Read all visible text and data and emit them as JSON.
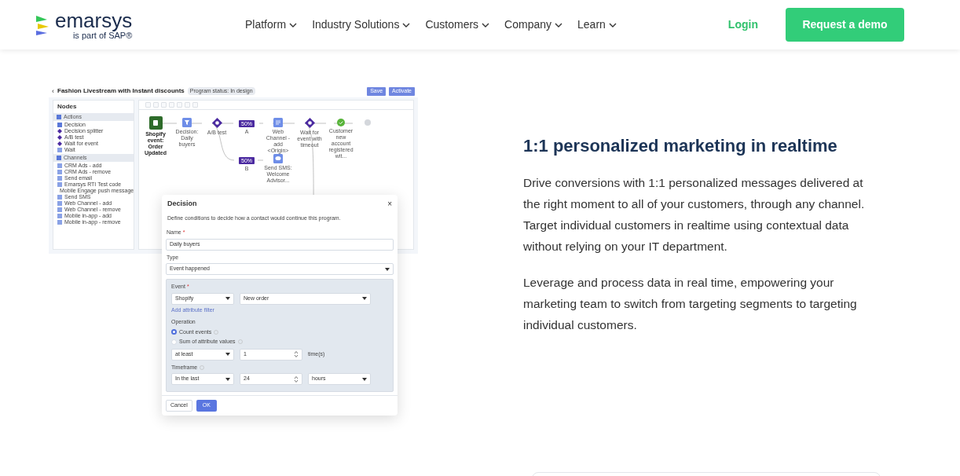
{
  "header": {
    "logo": {
      "name": "emarsys",
      "tagline": "is part of SAP®"
    },
    "nav": [
      {
        "label": "Platform"
      },
      {
        "label": "Industry Solutions"
      },
      {
        "label": "Customers"
      },
      {
        "label": "Company"
      },
      {
        "label": "Learn"
      }
    ],
    "login": "Login",
    "cta": "Request a demo"
  },
  "app_preview": {
    "back": "‹",
    "title": "Fashion Livestream with Instant discounts",
    "status": "Program status: In design",
    "buttons": [
      "Save",
      "Activate"
    ],
    "nodes_panel": {
      "title": "Nodes",
      "sections": [
        {
          "title": "Actions",
          "items": [
            {
              "label": "Decision",
              "kind": "decision"
            },
            {
              "label": "Decision splitter",
              "kind": "diamond"
            },
            {
              "label": "A/B test",
              "kind": "diamond"
            },
            {
              "label": "Wait for event",
              "kind": "diamond"
            },
            {
              "label": "Wait",
              "kind": "square"
            }
          ]
        },
        {
          "title": "Channels",
          "items": [
            {
              "label": "CRM Ads - add",
              "kind": "square"
            },
            {
              "label": "CRM Ads - remove",
              "kind": "square"
            },
            {
              "label": "Send email",
              "kind": "square"
            },
            {
              "label": "Emarsys RTI Test code",
              "kind": "square"
            },
            {
              "label": "Mobile Engage push message",
              "kind": "square"
            },
            {
              "label": "Send SMS",
              "kind": "square"
            },
            {
              "label": "Web Channel - add",
              "kind": "square"
            },
            {
              "label": "Web Channel - remove",
              "kind": "square"
            },
            {
              "label": "Mobile in-app - add",
              "kind": "square"
            },
            {
              "label": "Mobile in-app - remove",
              "kind": "square"
            }
          ]
        }
      ]
    },
    "flow": [
      {
        "kind": "event",
        "label": "Shopify event: Order Updated"
      },
      {
        "kind": "decision",
        "label": "Decision: Daily buyers"
      },
      {
        "kind": "abtest",
        "label": "A/B test"
      },
      {
        "kind": "split",
        "badge": "50%",
        "label": "A"
      },
      {
        "kind": "channel",
        "label": "Web Channel - add <Origin>"
      },
      {
        "kind": "wait",
        "label": "Wait for event with timeout"
      },
      {
        "kind": "check",
        "label": "Customer new account registered wit..."
      },
      {
        "kind": "end"
      },
      {
        "kind": "split",
        "badge": "50%",
        "label": "B"
      },
      {
        "kind": "sms",
        "label": "Send SMS: Welcome Advisor..."
      }
    ],
    "dialog": {
      "title": "Decision",
      "close": "×",
      "description": "Define conditions to decide how a contact would continue this program.",
      "required_mark": "*",
      "name_label": "Name",
      "name_value": "Daily buyers",
      "type_label": "Type",
      "type_value": "Event happened",
      "event_label": "Event",
      "event_source": "Shopify",
      "event_name": "New order",
      "filter_link": "Add attribute filter",
      "operation_label": "Operation",
      "operations": [
        {
          "label": "Count events",
          "selected": true
        },
        {
          "label": "Sum of attribute values",
          "selected": false
        }
      ],
      "comparator": "at least",
      "count": "1",
      "count_unit": "time(s)",
      "timeframe_label": "Timeframe",
      "timeframe_mode": "In the last",
      "timeframe_value": "24",
      "timeframe_unit": "hours",
      "cancel": "Cancel",
      "ok": "OK"
    }
  },
  "article": {
    "heading": "1:1 personalized marketing in realtime",
    "paragraphs": [
      "Drive conversions with 1:1 personalized messages delivered at the right moment to all of your customers, through any channel. Target individual customers in realtime using contextual data without relying on your IT department.",
      "Leverage and process data in real time, empowering your marketing team to switch from targeting segments to targeting individual customers."
    ]
  }
}
